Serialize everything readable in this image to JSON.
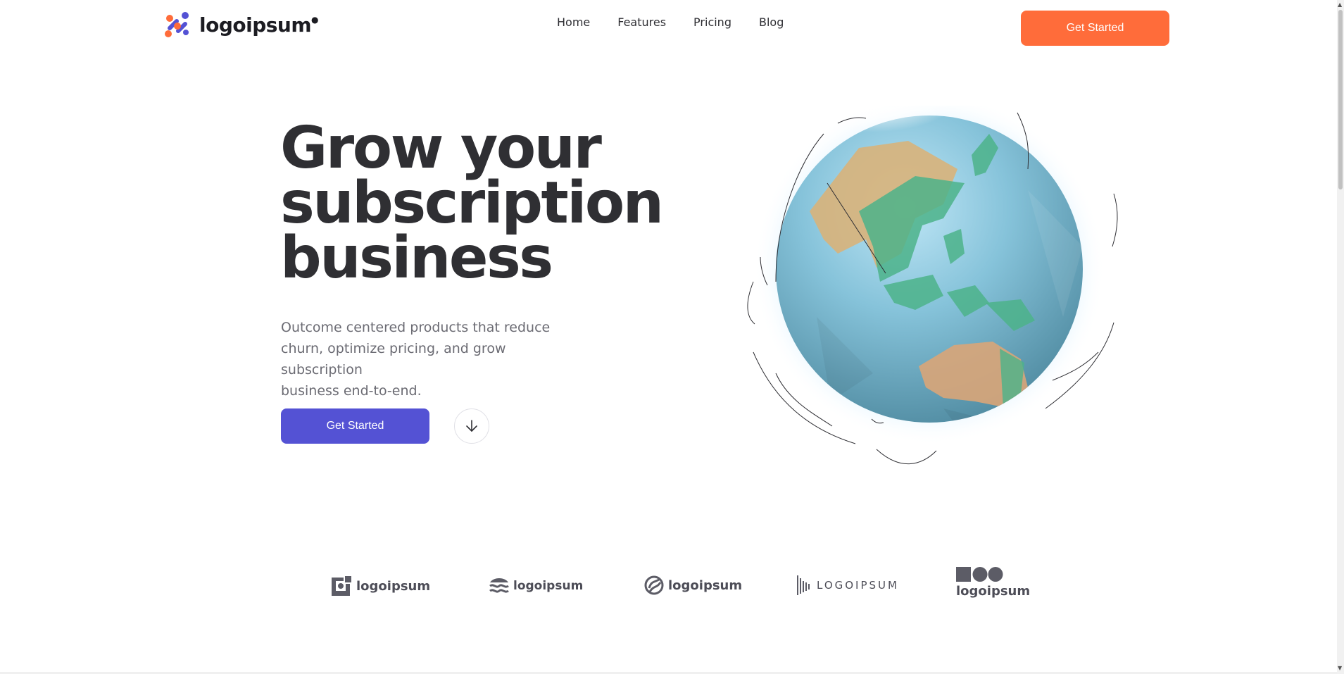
{
  "header": {
    "logo_text": "logoipsum",
    "nav": [
      "Home",
      "Features",
      "Pricing",
      "Blog"
    ],
    "cta_label": "Get Started"
  },
  "hero": {
    "title_lines": [
      "Grow your",
      "subscription",
      "business"
    ],
    "subtitle_lines": [
      "Outcome centered products that reduce",
      "churn, optimize pricing, and grow subscription",
      "business end-to-end."
    ],
    "primary_cta": "Get Started",
    "scroll_icon": "arrow-down-icon",
    "globe_icon": "globe-illustration"
  },
  "logos": [
    {
      "name": "logoipsum",
      "icon": "square-logo-icon"
    },
    {
      "name": "logoipsum",
      "icon": "waves-logo-icon"
    },
    {
      "name": "logoipsum",
      "icon": "circle-stripes-logo-icon"
    },
    {
      "name": "LOGOIPSUM",
      "icon": "barcode-logo-icon"
    },
    {
      "name": "logoipsum",
      "icon": "shapes-logo-icon"
    }
  ],
  "colors": {
    "accent_orange": "#ff6c3a",
    "primary_indigo": "#5452d4",
    "heading": "#2f2f33",
    "body_text": "#6b6b73"
  }
}
